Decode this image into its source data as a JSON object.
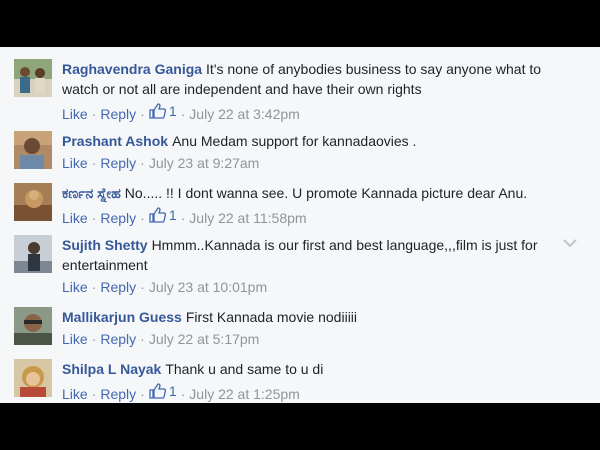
{
  "comments": [
    {
      "author": "Raghavendra Ganiga",
      "text": "It's none of anybodies business to say anyone what to watch or not all are independent and have their own rights",
      "like_label": "Like",
      "reply_label": "Reply",
      "likes": "1",
      "time": "July 22 at 3:42pm"
    },
    {
      "author": "Prashant Ashok",
      "text": "Anu Medam support for kannadaovies .",
      "like_label": "Like",
      "reply_label": "Reply",
      "time": "July 23 at 9:27am"
    },
    {
      "author": "ಕರ್ಣನ ಸ್ನೇಹ",
      "text": "No..... !! I dont wanna see. U promote Kannada picture dear Anu.",
      "like_label": "Like",
      "reply_label": "Reply",
      "likes": "1",
      "time": "July 22 at 11:58pm"
    },
    {
      "author": "Sujith Shetty",
      "text": "Hmmm..Kannada is our first and best language,,,film is just for entertainment",
      "like_label": "Like",
      "reply_label": "Reply",
      "time": "July 23 at 10:01pm"
    },
    {
      "author": "Mallikarjun Guess",
      "text": "First Kannada movie nodiiiii",
      "like_label": "Like",
      "reply_label": "Reply",
      "time": "July 22 at 5:17pm"
    },
    {
      "author": "Shilpa L Nayak",
      "text": "Thank u and same to u di",
      "like_label": "Like",
      "reply_label": "Reply",
      "likes": "1",
      "time": "July 22 at 1:25pm"
    }
  ],
  "colors": {
    "author": "#365899",
    "link": "#4267b2",
    "meta": "#90949c",
    "background": "#f6f7f9"
  },
  "icons": {
    "thumb": "thumbs-up-icon",
    "chevron": "chevron-down-icon"
  }
}
